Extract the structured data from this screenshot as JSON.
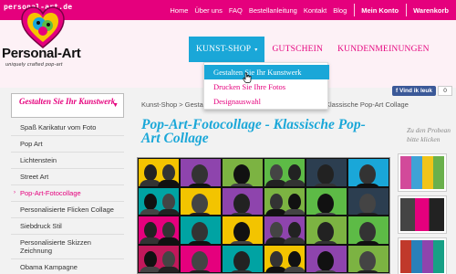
{
  "site": {
    "domain": "personal-art.de",
    "logo_name": "Personal-Art",
    "logo_tagline": "uniquely crafted pop-art"
  },
  "topnav": {
    "items": [
      "Home",
      "Über uns",
      "FAQ",
      "Bestellanleitung",
      "Kontakt",
      "Blog"
    ],
    "account": "Mein Konto",
    "cart": "Warenkorb"
  },
  "mainnav": {
    "items": [
      {
        "label": "KUNST-SHOP",
        "active": true
      },
      {
        "label": "GUTSCHEIN",
        "active": false
      },
      {
        "label": "KUNDENMEINUNGEN",
        "active": false
      }
    ],
    "dropdown": [
      {
        "label": "Gestalten Sie Ihr Kunstwerk",
        "hover": true
      },
      {
        "label": "Drucken Sie Ihre Fotos",
        "hover": false
      },
      {
        "label": "Designauswahl",
        "hover": false
      }
    ]
  },
  "sidebar": {
    "heading": "Gestalten Sie Ihr Kunstwerk",
    "items": [
      {
        "label": "Spaß Karikatur vom Foto",
        "current": false
      },
      {
        "label": "Pop Art",
        "current": false
      },
      {
        "label": "Lichtenstein",
        "current": false
      },
      {
        "label": "Street Art",
        "current": false
      },
      {
        "label": "Pop-Art-Fotocollage",
        "current": true
      },
      {
        "label": "Personalisierte Flicken Collage",
        "current": false
      },
      {
        "label": "Siebdruck Stil",
        "current": false
      },
      {
        "label": "Personalisierte Skizzen Zeichnung",
        "current": false
      },
      {
        "label": "Obama Kampagne",
        "current": false
      }
    ]
  },
  "social": {
    "fb_label": "Vind ik leuk",
    "fb_count": "0"
  },
  "breadcrumb": {
    "start": "Kunst-Shop > Gestalte",
    "end": "Klassische Pop-Art Collage"
  },
  "product": {
    "title": "Pop-Art-Fotocollage - Klassische Pop-Art Collage"
  },
  "rail": {
    "hint_line1": "Zu den Probean",
    "hint_line2": "bitte klicken"
  },
  "colors": {
    "brand_pink": "#e5007d",
    "accent_blue": "#1aa7d8"
  }
}
